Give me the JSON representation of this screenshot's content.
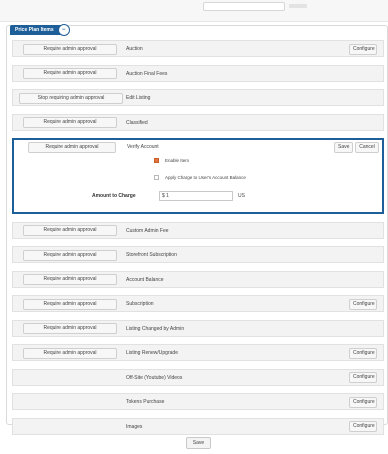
{
  "panel": {
    "title": "Price Plan Items"
  },
  "buttons": {
    "require_admin_approval": "Require admin approval",
    "stop_requiring_admin_approval": "Stop requiring admin approval",
    "configure": "Configure",
    "save": "Save",
    "cancel": "Cancel"
  },
  "rows": [
    {
      "label": "Auction",
      "action": "require",
      "configure": true
    },
    {
      "label": "Auction Final Fees",
      "action": "require",
      "configure": false
    },
    {
      "label": "Edit Listing",
      "action": "stop",
      "configure": false
    },
    {
      "label": "Classified",
      "action": "require",
      "configure": false
    },
    {
      "label": "Verify Account",
      "action": "require",
      "expanded": true
    },
    {
      "label": "Custom Admin Fee",
      "action": "require",
      "configure": false
    },
    {
      "label": "Storefront Subscription",
      "action": "require",
      "configure": false
    },
    {
      "label": "Account Balance",
      "action": "require",
      "configure": false
    },
    {
      "label": "Subscription",
      "action": "require",
      "configure": true
    },
    {
      "label": "Listing Changed by Admin",
      "action": "require",
      "configure": false
    },
    {
      "label": "Listing Renew/Upgrade",
      "action": "require",
      "configure": true
    },
    {
      "label": "Off-Site (Youtube) Videos",
      "action": "none",
      "configure": true
    },
    {
      "label": "Tokens Purchase",
      "action": "none",
      "configure": true
    },
    {
      "label": "Images",
      "action": "none",
      "configure": true
    }
  ],
  "verify_account": {
    "enable_item_label": "Enable Item",
    "enable_item_checked": true,
    "apply_charge_label": "Apply Charge to User's Account Balance",
    "apply_charge_checked": false,
    "amount_label": "Amount to Charge",
    "amount_value": "$ 1",
    "amount_unit": "US"
  },
  "footer": {
    "save_label": "Save"
  },
  "colors": {
    "accent": "#1f5f99",
    "checkbox_checked": "#e2733a"
  }
}
